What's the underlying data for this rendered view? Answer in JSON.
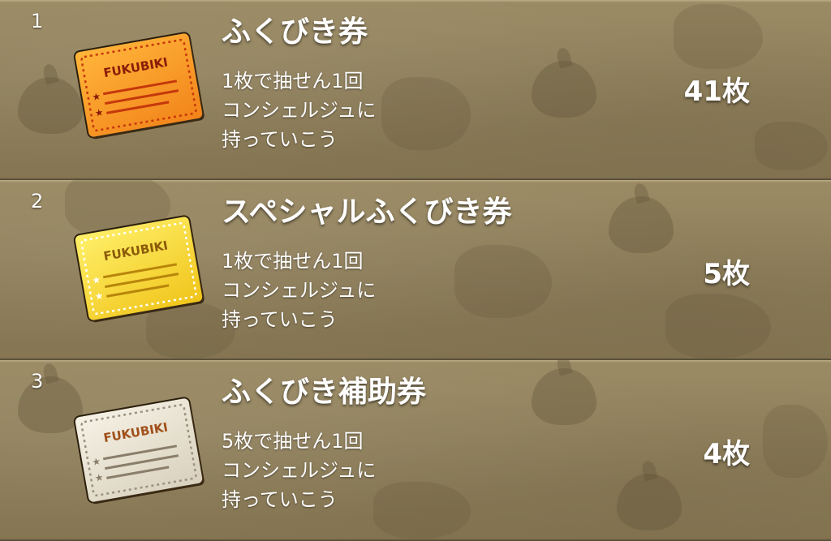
{
  "items": [
    {
      "index": "1",
      "name": "ふくびき券",
      "desc": [
        "1枚で抽せん1回",
        "コンシェルジュに",
        "持っていこう"
      ],
      "count": "41枚",
      "ticket_color": "#f7a126",
      "ticket_icon": "lottery-ticket-orange-icon"
    },
    {
      "index": "2",
      "name": "スペシャルふくびき券",
      "desc": [
        "1枚で抽せん1回",
        "コンシェルジュに",
        "持っていこう"
      ],
      "count": "5枚",
      "ticket_color": "#f6d52c",
      "ticket_icon": "lottery-ticket-gold-icon"
    },
    {
      "index": "3",
      "name": "ふくびき補助券",
      "desc": [
        "5枚で抽せん1回",
        "コンシェルジュに",
        "持っていこう"
      ],
      "count": "4枚",
      "ticket_color": "#ece6d4",
      "ticket_icon": "lottery-ticket-silver-icon"
    }
  ],
  "colors": {
    "panel_background": "#8e7e5a",
    "divider_dark": "#4e4430",
    "divider_light": "#bcae88",
    "text": "#ffffff"
  }
}
